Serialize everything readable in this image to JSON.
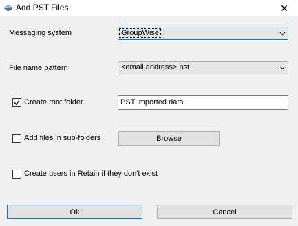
{
  "window": {
    "title": "Add PST Files",
    "close_glyph": "✕"
  },
  "messaging_system": {
    "label": "Messaging system",
    "value": "GroupWise"
  },
  "file_name_pattern": {
    "label": "File name pattern",
    "value": "<email address>.pst"
  },
  "create_root_folder": {
    "label": "Create root folder",
    "checked": true,
    "value": "PST imported data"
  },
  "add_subfolders": {
    "label": "Add files in sub-folders",
    "checked": false,
    "browse_label": "Browse"
  },
  "create_users": {
    "label": "Create users in Retain if they don't exist",
    "checked": false
  },
  "buttons": {
    "ok": "Ok",
    "cancel": "Cancel"
  },
  "colors": {
    "focus_border": "#0078d7",
    "dialog_bg": "#f0f0f0",
    "title_bg": "#ffffff"
  },
  "icons": [
    "app-icon",
    "close-icon",
    "chevron-down-icon",
    "checkmark-icon"
  ]
}
